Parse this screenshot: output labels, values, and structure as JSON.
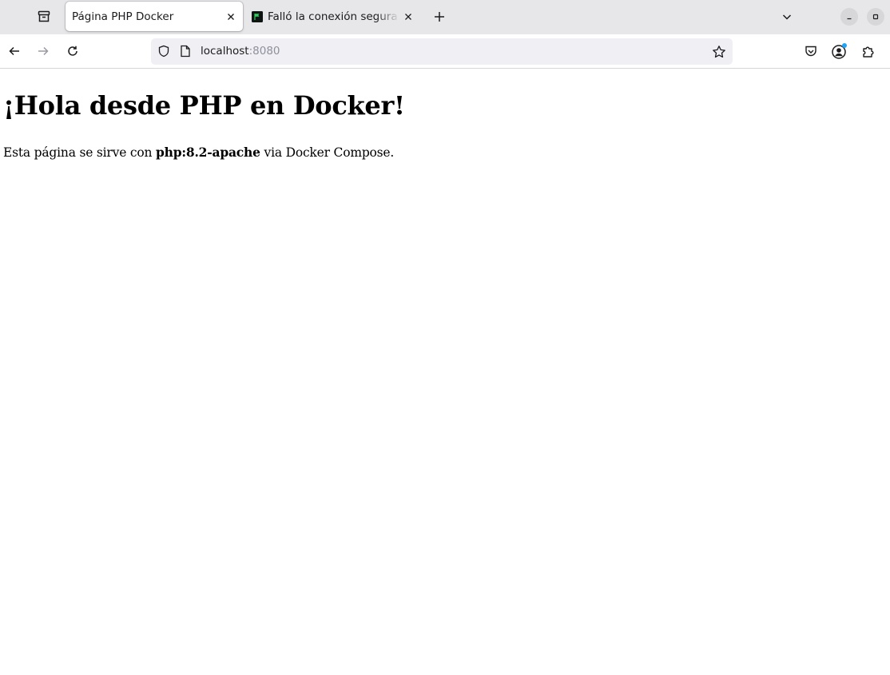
{
  "browser": {
    "tabs": [
      {
        "title": "Página PHP Docker",
        "active": true,
        "favicon": "none"
      },
      {
        "title": "Falló la conexión segura y",
        "active": false,
        "favicon": "terminal-flag-icon"
      }
    ],
    "url": {
      "host": "localhost",
      "port": ":8080"
    }
  },
  "page": {
    "heading": "¡Hola desde PHP en Docker!",
    "paragraph": {
      "before": "Esta página se sirve con ",
      "strong": "php:8.2-apache",
      "after": " via Docker Compose."
    }
  },
  "colors": {
    "tabbar_bg": "#e7e6e9",
    "urlbar_bg": "#f0f0f4",
    "icon": "#1b1b1d",
    "muted_text": "#8f8f9d",
    "account_badge": "#20a4f3",
    "favicon_bg": "#0e1412",
    "favicon_accent": "#2fcf5c"
  }
}
